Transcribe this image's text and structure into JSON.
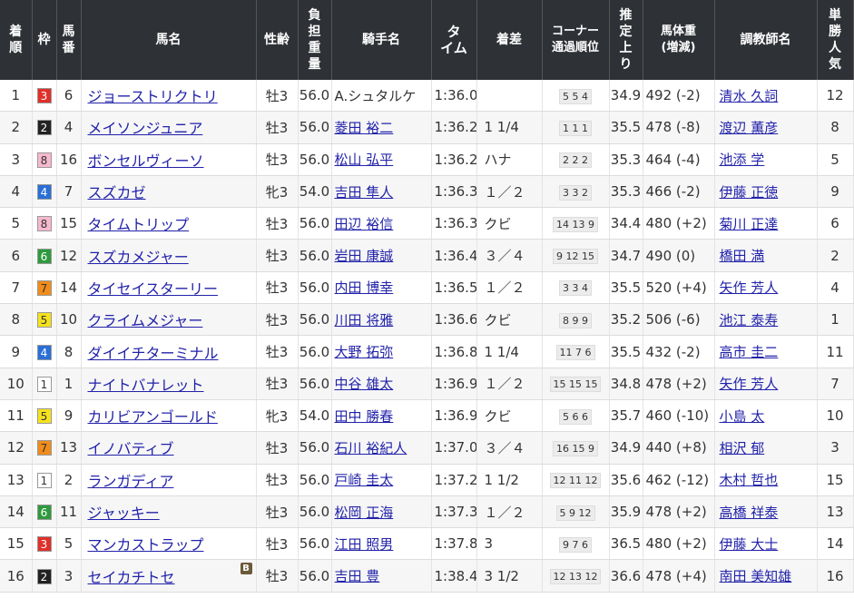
{
  "headers": {
    "rank": "着順",
    "waku": "枠",
    "umaban": "馬番",
    "name": "馬名",
    "sex_age": "性齢",
    "weight": "負担重量",
    "jockey": "騎手名",
    "time": "タイム",
    "margin": "着差",
    "corner": "コーナー通過順位",
    "last3f": "推定上り",
    "body_weight": "馬体重(増減)",
    "trainer": "調教師名",
    "popularity": "単勝人気"
  },
  "waku_colors": {
    "1": {
      "bg": "#ffffff",
      "fg": "#333333"
    },
    "2": {
      "bg": "#222222",
      "fg": "#ffffff"
    },
    "3": {
      "bg": "#e0302a",
      "fg": "#ffffff"
    },
    "4": {
      "bg": "#2a6fd6",
      "fg": "#ffffff"
    },
    "5": {
      "bg": "#f5e21c",
      "fg": "#333333"
    },
    "6": {
      "bg": "#2e9a3e",
      "fg": "#ffffff"
    },
    "7": {
      "bg": "#f08c1a",
      "fg": "#333333"
    },
    "8": {
      "bg": "#f7b8cf",
      "fg": "#333333"
    }
  },
  "rows": [
    {
      "rank": "1",
      "waku": "3",
      "umaban": "6",
      "name": "ジョーストリクトリ",
      "blinker": "",
      "sex_age": "牡3",
      "weight": "56.0",
      "jockey": "A.シュタルケ",
      "jockey_link": false,
      "time": "1:36.0",
      "margin": "",
      "corner": "5 5 4",
      "last3f": "34.9",
      "body_weight": "492 (-2)",
      "trainer": "清水 久詞",
      "popularity": "12"
    },
    {
      "rank": "2",
      "waku": "2",
      "umaban": "4",
      "name": "メイソンジュニア",
      "blinker": "",
      "sex_age": "牡3",
      "weight": "56.0",
      "jockey": "菱田 裕二",
      "jockey_link": true,
      "time": "1:36.2",
      "margin": "1 1/4",
      "corner": "1 1 1",
      "last3f": "35.5",
      "body_weight": "478 (-8)",
      "trainer": "渡辺 薫彦",
      "popularity": "8"
    },
    {
      "rank": "3",
      "waku": "8",
      "umaban": "16",
      "name": "ボンセルヴィーソ",
      "blinker": "",
      "sex_age": "牡3",
      "weight": "56.0",
      "jockey": "松山 弘平",
      "jockey_link": true,
      "time": "1:36.2",
      "margin": "ハナ",
      "corner": "2 2 2",
      "last3f": "35.3",
      "body_weight": "464 (-4)",
      "trainer": "池添 学",
      "popularity": "5"
    },
    {
      "rank": "4",
      "waku": "4",
      "umaban": "7",
      "name": "スズカゼ",
      "blinker": "",
      "sex_age": "牝3",
      "weight": "54.0",
      "jockey": "吉田 隼人",
      "jockey_link": true,
      "time": "1:36.3",
      "margin": "１／２",
      "corner": "3 3 2",
      "last3f": "35.3",
      "body_weight": "466 (-2)",
      "trainer": "伊藤 正徳",
      "popularity": "9"
    },
    {
      "rank": "5",
      "waku": "8",
      "umaban": "15",
      "name": "タイムトリップ",
      "blinker": "",
      "sex_age": "牡3",
      "weight": "56.0",
      "jockey": "田辺 裕信",
      "jockey_link": true,
      "time": "1:36.3",
      "margin": "クビ",
      "corner": "14 13 9",
      "last3f": "34.4",
      "body_weight": "480 (+2)",
      "trainer": "菊川 正達",
      "popularity": "6"
    },
    {
      "rank": "6",
      "waku": "6",
      "umaban": "12",
      "name": "スズカメジャー",
      "blinker": "",
      "sex_age": "牡3",
      "weight": "56.0",
      "jockey": "岩田 康誠",
      "jockey_link": true,
      "time": "1:36.4",
      "margin": "３／４",
      "corner": "9 12 15",
      "last3f": "34.7",
      "body_weight": "490 (0)",
      "trainer": "橋田 満",
      "popularity": "2"
    },
    {
      "rank": "7",
      "waku": "7",
      "umaban": "14",
      "name": "タイセイスターリー",
      "blinker": "",
      "sex_age": "牡3",
      "weight": "56.0",
      "jockey": "内田 博幸",
      "jockey_link": true,
      "time": "1:36.5",
      "margin": "１／２",
      "corner": "3 3 4",
      "last3f": "35.5",
      "body_weight": "520 (+4)",
      "trainer": "矢作 芳人",
      "popularity": "4"
    },
    {
      "rank": "8",
      "waku": "5",
      "umaban": "10",
      "name": "クライムメジャー",
      "blinker": "",
      "sex_age": "牡3",
      "weight": "56.0",
      "jockey": "川田 将雅",
      "jockey_link": true,
      "time": "1:36.6",
      "margin": "クビ",
      "corner": "8 9 9",
      "last3f": "35.2",
      "body_weight": "506 (-6)",
      "trainer": "池江 泰寿",
      "popularity": "1"
    },
    {
      "rank": "9",
      "waku": "4",
      "umaban": "8",
      "name": "ダイイチターミナル",
      "blinker": "",
      "sex_age": "牡3",
      "weight": "56.0",
      "jockey": "大野 拓弥",
      "jockey_link": true,
      "time": "1:36.8",
      "margin": "1 1/4",
      "corner": "11 7 6",
      "last3f": "35.5",
      "body_weight": "432 (-2)",
      "trainer": "高市 圭二",
      "popularity": "11"
    },
    {
      "rank": "10",
      "waku": "1",
      "umaban": "1",
      "name": "ナイトバナレット",
      "blinker": "",
      "sex_age": "牡3",
      "weight": "56.0",
      "jockey": "中谷 雄太",
      "jockey_link": true,
      "time": "1:36.9",
      "margin": "１／２",
      "corner": "15 15 15",
      "last3f": "34.8",
      "body_weight": "478 (+2)",
      "trainer": "矢作 芳人",
      "popularity": "7"
    },
    {
      "rank": "11",
      "waku": "5",
      "umaban": "9",
      "name": "カリビアンゴールド",
      "blinker": "",
      "sex_age": "牝3",
      "weight": "54.0",
      "jockey": "田中 勝春",
      "jockey_link": true,
      "time": "1:36.9",
      "margin": "クビ",
      "corner": "5 6 6",
      "last3f": "35.7",
      "body_weight": "460 (-10)",
      "trainer": "小島 太",
      "popularity": "10"
    },
    {
      "rank": "12",
      "waku": "7",
      "umaban": "13",
      "name": "イノバティブ",
      "blinker": "",
      "sex_age": "牡3",
      "weight": "56.0",
      "jockey": "石川 裕紀人",
      "jockey_link": true,
      "time": "1:37.0",
      "margin": "３／４",
      "corner": "16 15 9",
      "last3f": "34.9",
      "body_weight": "440 (+8)",
      "trainer": "相沢 郁",
      "popularity": "3"
    },
    {
      "rank": "13",
      "waku": "1",
      "umaban": "2",
      "name": "ランガディア",
      "blinker": "",
      "sex_age": "牡3",
      "weight": "56.0",
      "jockey": "戸崎 圭太",
      "jockey_link": true,
      "time": "1:37.2",
      "margin": "1 1/2",
      "corner": "12 11 12",
      "last3f": "35.6",
      "body_weight": "462 (-12)",
      "trainer": "木村 哲也",
      "popularity": "15"
    },
    {
      "rank": "14",
      "waku": "6",
      "umaban": "11",
      "name": "ジャッキー",
      "blinker": "",
      "sex_age": "牡3",
      "weight": "56.0",
      "jockey": "松岡 正海",
      "jockey_link": true,
      "time": "1:37.3",
      "margin": "１／２",
      "corner": "5 9 12",
      "last3f": "35.9",
      "body_weight": "478 (+2)",
      "trainer": "高橋 祥泰",
      "popularity": "13"
    },
    {
      "rank": "15",
      "waku": "3",
      "umaban": "5",
      "name": "マンカストラップ",
      "blinker": "",
      "sex_age": "牡3",
      "weight": "56.0",
      "jockey": "江田 照男",
      "jockey_link": true,
      "time": "1:37.8",
      "margin": "3",
      "corner": "9 7 6",
      "last3f": "36.5",
      "body_weight": "480 (+2)",
      "trainer": "伊藤 大士",
      "popularity": "14"
    },
    {
      "rank": "16",
      "waku": "2",
      "umaban": "3",
      "name": "セイカチトセ",
      "blinker": "B",
      "sex_age": "牡3",
      "weight": "56.0",
      "jockey": "吉田 豊",
      "jockey_link": true,
      "time": "1:38.4",
      "margin": "3 1/2",
      "corner": "12 13 12",
      "last3f": "36.6",
      "body_weight": "478 (+4)",
      "trainer": "南田 美知雄",
      "popularity": "16"
    }
  ]
}
